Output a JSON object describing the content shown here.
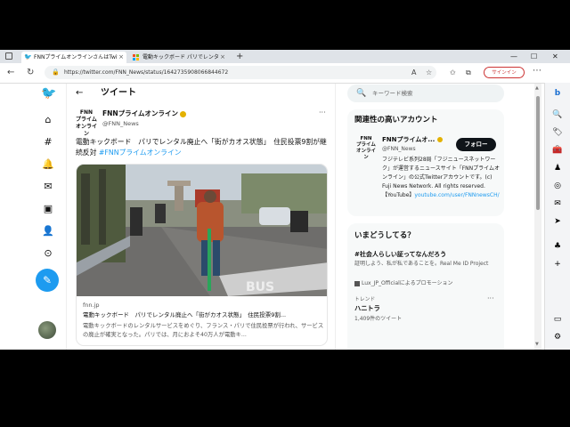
{
  "tabs": [
    {
      "title": "FNNプライムオンラインさんはTwitterを",
      "icon": "twitter-icon",
      "close": "×"
    },
    {
      "title": "電動キックボード パリでレンタル廃止",
      "icon": "microsoft-icon",
      "close": "×"
    }
  ],
  "newtab": "+",
  "window": {
    "minimize": "—",
    "maximize": "☐",
    "close": "✕"
  },
  "address": {
    "url": "https://twitter.com/FNN_News/status/1642735908066844672",
    "signin": "サインイン"
  },
  "page": {
    "title": "ツイート",
    "back": "←"
  },
  "tweet": {
    "author_name": "FNNプライムオンライン",
    "author_handle": "@FNN_News",
    "logo": [
      "FNN",
      "プライム",
      "オンライン"
    ],
    "text": "電動キックボード　パリでレンタル廃止へ「街がカオス状態」　住民投票9割が継続反対 ",
    "hashtag": "#FNNプライムオンライン",
    "card": {
      "domain": "fnn.jp",
      "title": "電動キックボード　パリでレンタル廃止へ「街がカオス状態」　住民投票9割...",
      "desc": "電動キックボードのレンタルサービスをめぐり、フランス・パリで住民投票が行われ、サービスの廃止が確実となった。パリでは、月におよそ40万人が電動キ..."
    }
  },
  "search": {
    "placeholder": "キーワード検索"
  },
  "related": {
    "title": "関連性の高いアカウント",
    "name": "FNNプライムオ...",
    "handle": "@FNN_News",
    "follow": "フォロー",
    "bio": "フジテレビ系列28局「フジニュースネットワーク」が運営するニュースサイト「FNNプライムオンライン」の公式Twitterアカウントです。(c) Fuji News Network. All rights reserved.【YouTube】",
    "bio_link": "youtube.com/user/FNNnewsCH/"
  },
  "trends": {
    "title": "いまどうしてる？",
    "t1_title": "#社会人らしい証ってなんだろう",
    "t1_desc": "証明しよう、私が私であることを。Real Me ID Project",
    "t1_promo": "Lux_JP_Officialによるプロモーション",
    "t2_category": "トレンド",
    "t2_title": "ハニトラ",
    "t2_count": "1,409件のツイート"
  },
  "colors": {
    "twitter_blue": "#1d9bf0",
    "follow_bg": "#0f1419",
    "signin": "#cc3333"
  }
}
